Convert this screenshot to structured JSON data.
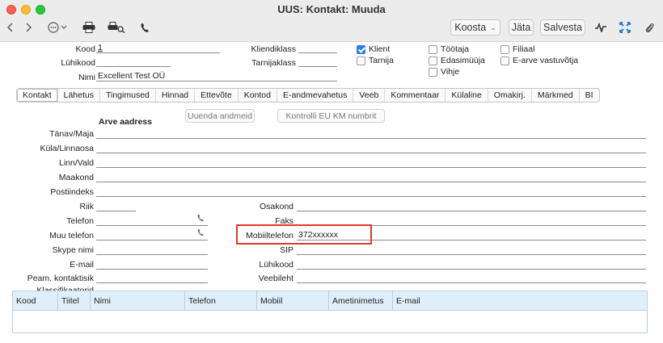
{
  "window": {
    "title": "UUS: Kontakt: Muuda"
  },
  "toolbar": {
    "back_icon": "chevron-left-icon",
    "forward_icon": "chevron-right-icon",
    "more_icon": "ellipsis-circle-icon",
    "print_icon": "printer-icon",
    "print_preview_icon": "print-preview-icon",
    "phone_icon": "phone-icon",
    "koosta_label": "Koosta",
    "jata_label": "Jäta",
    "salvesta_label": "Salvesta",
    "activity_icon": "activity-icon",
    "expand_icon": "expand-icon",
    "attach_icon": "paperclip-icon"
  },
  "header": {
    "kood_label": "Kood",
    "kood_value": "1",
    "luhikood_label": "Lühikood",
    "luhikood_value": "",
    "nimi_label": "Nimi",
    "nimi_value": "Excellent Test OÜ",
    "kliendiklass_label": "Kliendiklass",
    "kliendiklass_value": "",
    "tarnijaklass_label": "Tarnijaklass",
    "tarnijaklass_value": ""
  },
  "checkboxes": {
    "klient": {
      "label": "Klient",
      "checked": true
    },
    "tarnija": {
      "label": "Tarnija",
      "checked": false
    },
    "tootaja": {
      "label": "Töötaja",
      "checked": false
    },
    "edasimuuja": {
      "label": "Edasimüüja",
      "checked": false
    },
    "vihje": {
      "label": "Vihje",
      "checked": false
    },
    "filiaal": {
      "label": "Filiaal",
      "checked": false
    },
    "earve": {
      "label": "E-arve vastuvõtja",
      "checked": false
    }
  },
  "tabs": [
    "Kontakt",
    "Lähetus",
    "Tingimused",
    "Hinnad",
    "Ettevõte",
    "Kontod",
    "E-andmevahetus",
    "Veeb",
    "Kommentaar",
    "Külaline",
    "Omakirj.",
    "Märkmed",
    "BI"
  ],
  "address": {
    "section_title": "Arve aadress",
    "refresh_button": "Uuenda andmeid",
    "vat_button": "Kontrolli EU KM numbrit",
    "tanav_label": "Tänav/Maja",
    "kula_label": "Küla/Linnaosa",
    "linn_label": "Linn/Vald",
    "maakond_label": "Maakond",
    "postiindeks_label": "Postiindeks"
  },
  "contact": {
    "riik_label": "Riik",
    "telefon_label": "Telefon",
    "muu_telefon_label": "Muu telefon",
    "skype_label": "Skype nimi",
    "email_label": "E-mail",
    "peam_label": "Peam. kontaktisik",
    "klass_label": "Klassifikaatorid",
    "osakond_label": "Osakond",
    "faks_label": "Faks",
    "mobiil_label": "Mobiiltelefon",
    "mobiil_value": "372xxxxxx",
    "sip_label": "SIP",
    "luhikood2_label": "Lühikood",
    "veebileht_label": "Veebileht"
  },
  "grid": {
    "columns": [
      "Kood",
      "Tiitel",
      "Nimi",
      "Telefon",
      "Mobiil",
      "Ametinimetus",
      "E-mail"
    ]
  },
  "colors": {
    "highlight": "#e2382d",
    "grid_header": "#dff0fb",
    "checkbox": "#2b7de9"
  }
}
